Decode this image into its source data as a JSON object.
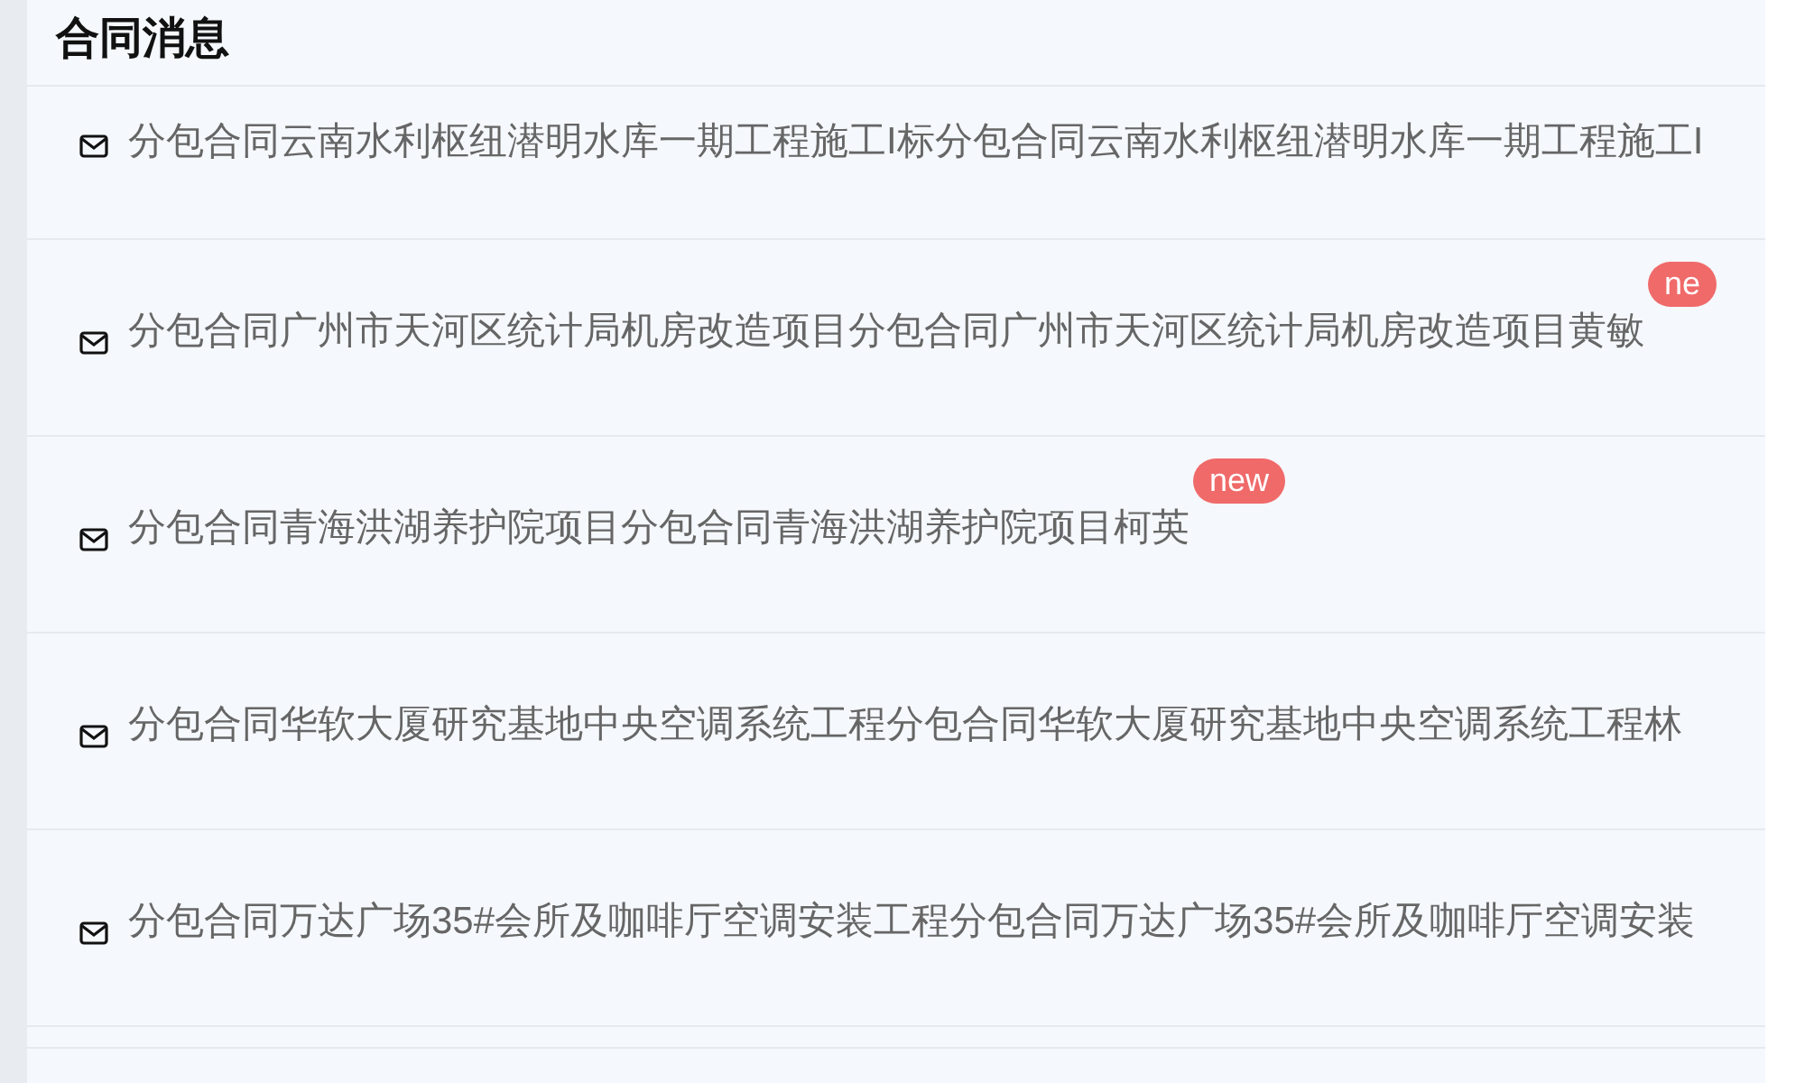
{
  "title": "合同消息",
  "messages": [
    {
      "text": "分包合同云南水利枢纽潜明水库一期工程施工I标分包合同云南水利枢纽潜明水库一期工程施工I"
    },
    {
      "text": "分包合同广州市天河区统计局机房改造项目分包合同广州市天河区统计局机房改造项目黄敏",
      "badge": "ne"
    },
    {
      "text": "分包合同青海洪湖养护院项目分包合同青海洪湖养护院项目柯英",
      "badge": "new"
    },
    {
      "text": "分包合同华软大厦研究基地中央空调系统工程分包合同华软大厦研究基地中央空调系统工程林"
    },
    {
      "text": "分包合同万达广场35#会所及咖啡厅空调安装工程分包合同万达广场35#会所及咖啡厅空调安装"
    }
  ]
}
